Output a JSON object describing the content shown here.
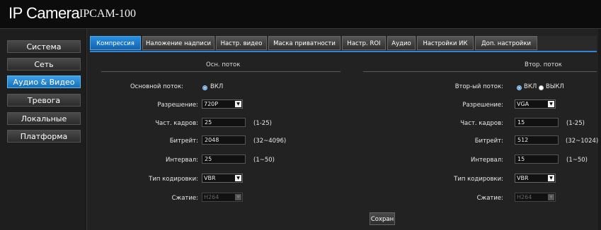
{
  "header": {
    "brand": "IP Camera",
    "model": "IPCAM-100"
  },
  "sidebar": {
    "items": [
      {
        "label": "Система"
      },
      {
        "label": "Сеть"
      },
      {
        "label": "Аудио & Видео"
      },
      {
        "label": "Тревога"
      },
      {
        "label": "Локальные"
      },
      {
        "label": "Платформа"
      }
    ],
    "active_index": 2
  },
  "tabs": [
    {
      "label": "Компрессия"
    },
    {
      "label": "Наложение надписи"
    },
    {
      "label": "Настр. видео"
    },
    {
      "label": "Маска приватности"
    },
    {
      "label": "Настр. ROI"
    },
    {
      "label": "Аудио"
    },
    {
      "label": "Настройки ИК"
    },
    {
      "label": "Доп. настройки"
    }
  ],
  "main_stream": {
    "title": "Осн. поток",
    "stream_label": "Основной поток:",
    "on_label": "ВКЛ",
    "resolution_label": "Разрешение:",
    "resolution_value": "720P",
    "framerate_label": "Част. кадров:",
    "framerate_value": "25",
    "framerate_range": "(1-25)",
    "bitrate_label": "Битрейт:",
    "bitrate_value": "2048",
    "bitrate_range": "(32~4096)",
    "interval_label": "Интервал:",
    "interval_value": "25",
    "interval_range": "(1~50)",
    "encoding_label": "Тип кодировки:",
    "encoding_value": "VBR",
    "compression_label": "Сжатие:",
    "compression_value": "H264"
  },
  "sub_stream": {
    "title": "Втор. поток",
    "stream_label": "Втор-ый поток:",
    "on_label": "ВКЛ",
    "off_label": "ВЫКЛ",
    "resolution_label": "Разрешение:",
    "resolution_value": "VGA",
    "framerate_label": "Част. кадров:",
    "framerate_value": "15",
    "framerate_range": "(1-25)",
    "bitrate_label": "Битрейт:",
    "bitrate_value": "512",
    "bitrate_range": "(32~1024)",
    "interval_label": "Интервал:",
    "interval_value": "15",
    "interval_range": "(1~50)",
    "encoding_label": "Тип кодировки:",
    "encoding_value": "VBR",
    "compression_label": "Сжатие:",
    "compression_value": "H264"
  },
  "save_label": "Сохран",
  "colors": {
    "accent": "#1f7fd0",
    "background": "#1b1b1b"
  }
}
